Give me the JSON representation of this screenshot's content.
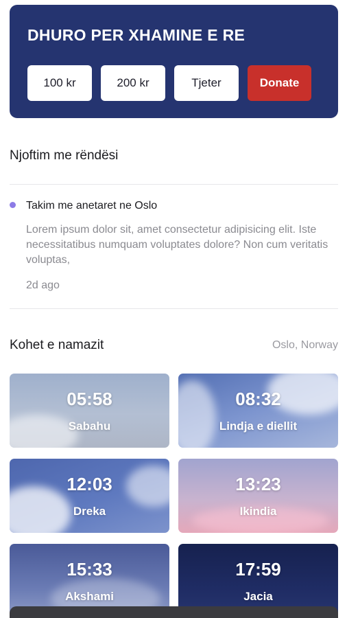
{
  "donate": {
    "title": "DHURO PER XHAMINE E RE",
    "amount_100": "100 kr",
    "amount_200": "200 kr",
    "other": "Tjeter",
    "donate_label": "Donate"
  },
  "notices": {
    "section_title": "Njoftim me rëndësi",
    "item": {
      "title": "Takim me anetaret ne Oslo",
      "body": "Lorem ipsum dolor sit, amet consectetur adipisicing elit. Iste necessitatibus numquam voluptates dolore? Non cum veritatis voluptas,",
      "time": "2d ago"
    }
  },
  "prayer": {
    "section_title": "Kohet e namazit",
    "location": "Oslo, Norway",
    "times": [
      {
        "time": "05:58",
        "name": "Sabahu"
      },
      {
        "time": "08:32",
        "name": "Lindja e diellit"
      },
      {
        "time": "12:03",
        "name": "Dreka"
      },
      {
        "time": "13:23",
        "name": "Ikindia"
      },
      {
        "time": "15:33",
        "name": "Akshami"
      },
      {
        "time": "17:59",
        "name": "Jacia"
      }
    ]
  },
  "colors": {
    "donate_card_bg": "#253470",
    "donate_button": "#c8302b",
    "notice_dot": "#8c7be6"
  }
}
